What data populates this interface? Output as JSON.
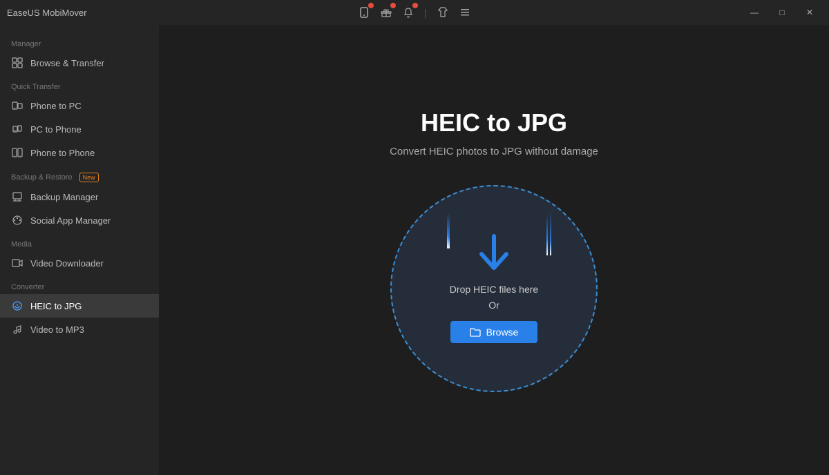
{
  "app": {
    "title": "EaseUS MobiMover"
  },
  "titlebar": {
    "icons": [
      {
        "name": "mobile-icon",
        "badge": true
      },
      {
        "name": "gift-icon",
        "badge": true
      },
      {
        "name": "bell-icon",
        "badge": true
      },
      {
        "name": "shirt-icon",
        "badge": false
      },
      {
        "name": "dropdown-icon",
        "badge": false
      }
    ],
    "controls": {
      "minimize": "—",
      "maximize": "□",
      "close": "✕"
    }
  },
  "sidebar": {
    "sections": [
      {
        "label": "Manager",
        "items": [
          {
            "id": "browse-transfer",
            "label": "Browse & Transfer",
            "icon": "grid-icon",
            "active": false
          }
        ]
      },
      {
        "label": "Quick Transfer",
        "items": [
          {
            "id": "phone-to-pc",
            "label": "Phone to PC",
            "icon": "phone-pc-icon",
            "active": false
          },
          {
            "id": "pc-to-phone",
            "label": "PC to Phone",
            "icon": "pc-phone-icon",
            "active": false
          },
          {
            "id": "phone-to-phone",
            "label": "Phone to Phone",
            "icon": "phone-phone-icon",
            "active": false
          }
        ]
      },
      {
        "label": "Backup & Restore",
        "new": true,
        "items": [
          {
            "id": "backup-manager",
            "label": "Backup Manager",
            "icon": "backup-icon",
            "active": false
          },
          {
            "id": "social-app-manager",
            "label": "Social App Manager",
            "icon": "social-icon",
            "active": false
          }
        ]
      },
      {
        "label": "Media",
        "items": [
          {
            "id": "video-downloader",
            "label": "Video Downloader",
            "icon": "video-icon",
            "active": false
          }
        ]
      },
      {
        "label": "Converter",
        "items": [
          {
            "id": "heic-to-jpg",
            "label": "HEIC to JPG",
            "icon": "heic-icon",
            "active": true
          },
          {
            "id": "video-to-mp3",
            "label": "Video to MP3",
            "icon": "mp3-icon",
            "active": false
          }
        ]
      }
    ]
  },
  "content": {
    "title": "HEIC to JPG",
    "subtitle": "Convert HEIC photos to JPG without damage",
    "drop_text_line1": "Drop HEIC files here",
    "drop_text_line2": "Or",
    "browse_label": "Browse"
  }
}
